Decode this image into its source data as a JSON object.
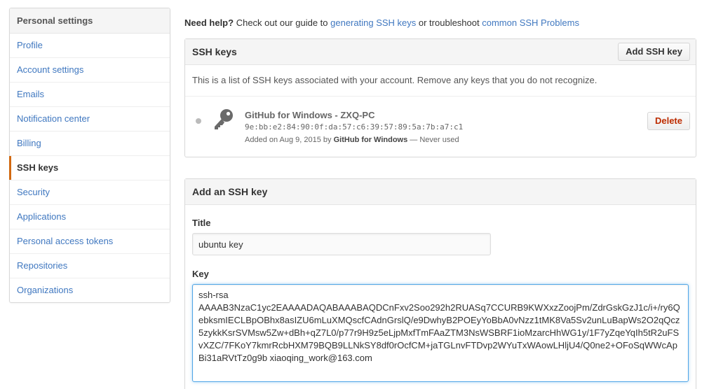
{
  "sidebar": {
    "header": "Personal settings",
    "items": [
      {
        "label": "Profile"
      },
      {
        "label": "Account settings"
      },
      {
        "label": "Emails"
      },
      {
        "label": "Notification center"
      },
      {
        "label": "Billing"
      },
      {
        "label": "SSH keys",
        "selected": true
      },
      {
        "label": "Security"
      },
      {
        "label": "Applications"
      },
      {
        "label": "Personal access tokens"
      },
      {
        "label": "Repositories"
      },
      {
        "label": "Organizations"
      }
    ]
  },
  "help": {
    "prefix_bold": "Need help?",
    "text1": "Check out our guide to",
    "link1": "generating SSH keys",
    "text2": "or troubleshoot",
    "link2": "common SSH Problems"
  },
  "ssh_keys": {
    "title": "SSH keys",
    "add_button": "Add SSH key",
    "description": "This is a list of SSH keys associated with your account. Remove any keys that you do not recognize.",
    "keys": [
      {
        "title": "GitHub for Windows - ZXQ-PC",
        "fingerprint": "9e:bb:e2:84:90:0f:da:57:c6:39:57:89:5a:7b:a7:c1",
        "added_prefix": "Added on Aug 9, 2015 by",
        "added_by": "GitHub for Windows",
        "usage": "— Never used",
        "delete_label": "Delete",
        "icon": "key-icon"
      }
    ]
  },
  "add_key": {
    "title": "Add an SSH key",
    "title_label": "Title",
    "title_value": "ubuntu key",
    "key_label": "Key",
    "key_value": "ssh-rsa\nAAAAB3NzaC1yc2EAAAADAQABAAABAQDCnFxv2Soo292h2RUASq7CCURB9KWXxzZoojPm/ZdrGskGzJ1c/i+/ry6QebksmIECLBpOBhx8asIZU6mLuXMQscfCAdnGrslQ/e9DwhyB2POEyYoBbA0vNzz1tMK8Va5Sv2unLuBapWs2O2qQcz5zykkKsrSVMsw5Zw+dBh+qZ7L0/p77r9H9z5eLjpMxfTmFAaZTM3NsWSBRF1ioMzarcHhWG1y/1F7yZqeYqIh5tR2uFSvXZC/7FKoY7kmrRcbHXM79BQB9LLNkSY8df0rOcfCM+jaTGLnvFTDvp2WYuTxWAowLHljU4/Q0ne2+OFoSqWWcApBi31aRVtTz0g9b xiaoqing_work@163.com"
  }
}
